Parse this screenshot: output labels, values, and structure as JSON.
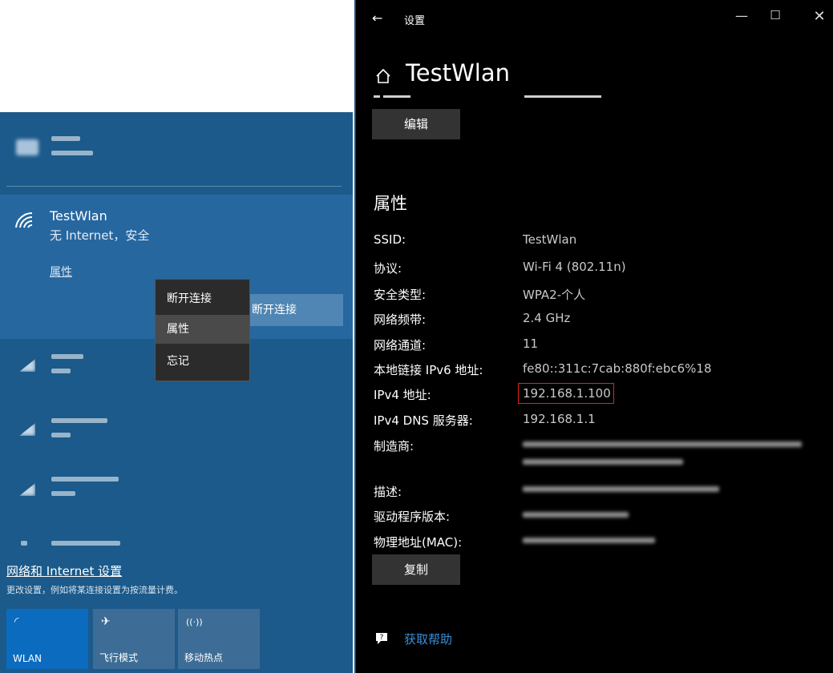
{
  "flyout": {
    "active_network": {
      "ssid": "TestWlan",
      "status": "无 Internet，安全",
      "properties_link": "属性",
      "disconnect_button": "断开连接"
    },
    "context_menu": {
      "items": [
        "断开连接",
        "属性",
        "忘记"
      ],
      "highlighted": "属性"
    },
    "settings_link": "网络和 Internet 设置",
    "settings_desc": "更改设置，例如将某连接设置为按流量计费。",
    "quick_tiles": [
      {
        "label": "WLAN",
        "icon": "wifi-icon",
        "active": true
      },
      {
        "label": "飞行模式",
        "icon": "airplane-icon",
        "active": false
      },
      {
        "label": "移动热点",
        "icon": "hotspot-icon",
        "active": false
      }
    ]
  },
  "window": {
    "title": "设置",
    "page_title": "TestWlan",
    "edit_button": "编辑",
    "section_title": "属性",
    "properties": [
      {
        "label": "SSID:",
        "value": "TestWlan"
      },
      {
        "label": "协议:",
        "value": "Wi-Fi 4 (802.11n)"
      },
      {
        "label": "安全类型:",
        "value": "WPA2-个人"
      },
      {
        "label": "网络频带:",
        "value": "2.4 GHz"
      },
      {
        "label": "网络通道:",
        "value": "11"
      },
      {
        "label": "本地链接 IPv6 地址:",
        "value": "fe80::311c:7cab:880f:ebc6%18"
      },
      {
        "label": "IPv4 地址:",
        "value": "192.168.1.100"
      },
      {
        "label": "IPv4 DNS 服务器:",
        "value": "192.168.1.1"
      },
      {
        "label": "制造商:",
        "value": ""
      },
      {
        "label": "描述:",
        "value": ""
      },
      {
        "label": "驱动程序版本:",
        "value": ""
      },
      {
        "label": "物理地址(MAC):",
        "value": ""
      }
    ],
    "copy_button": "复制",
    "help_link": "获取帮助"
  },
  "colors": {
    "flyout_bg": "#1b5a8a",
    "active_block": "#2667a0",
    "window_bg": "#000000",
    "highlight_box": "#e0202a",
    "link_blue": "#3a8fd9"
  }
}
